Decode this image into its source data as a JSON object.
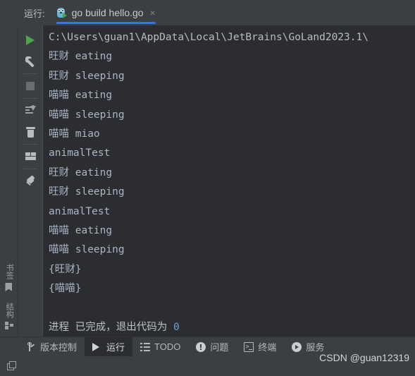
{
  "header": {
    "run_label": "运行:",
    "tab": {
      "title": "go build hello.go",
      "close": "×",
      "icon": "go-gopher-icon",
      "active_underline_color": "#3574F0"
    }
  },
  "left_strip": {
    "items": [
      {
        "label": "书签",
        "icon": "bookmark-icon"
      },
      {
        "label": "结构",
        "icon": "structure-icon"
      }
    ]
  },
  "run_toolbar": {
    "buttons": [
      {
        "name": "rerun-button",
        "icon": "play-icon"
      },
      {
        "name": "edit-configuration-button",
        "icon": "wrench-icon"
      },
      {
        "name": "stop-button",
        "icon": "stop-icon"
      },
      {
        "name": "scroll-to-end-button",
        "icon": "scroll-to-end-icon"
      },
      {
        "name": "clear-all-button",
        "icon": "trash-icon"
      },
      {
        "name": "layout-settings-button",
        "icon": "layout-icon"
      },
      {
        "name": "pin-tab-button",
        "icon": "pin-icon"
      }
    ]
  },
  "console": {
    "lines": [
      {
        "text": "C:\\Users\\guan1\\AppData\\Local\\JetBrains\\GoLand2023.1\\",
        "type": "path"
      },
      {
        "text": "旺财 eating",
        "type": "out"
      },
      {
        "text": "旺财 sleeping",
        "type": "out"
      },
      {
        "text": "喵喵 eating",
        "type": "out"
      },
      {
        "text": "喵喵 sleeping",
        "type": "out"
      },
      {
        "text": "喵喵 miao",
        "type": "out"
      },
      {
        "text": "animalTest",
        "type": "out"
      },
      {
        "text": "旺财 eating",
        "type": "out"
      },
      {
        "text": "旺财 sleeping",
        "type": "out"
      },
      {
        "text": "animalTest",
        "type": "out"
      },
      {
        "text": "喵喵 eating",
        "type": "out"
      },
      {
        "text": "喵喵 sleeping",
        "type": "out"
      },
      {
        "text": "{旺财}",
        "type": "out"
      },
      {
        "text": "{喵喵}",
        "type": "out"
      },
      {
        "text": "",
        "type": "blank"
      },
      {
        "text": "进程 已完成，退出代码为 0",
        "type": "exit",
        "exit_code": "0"
      }
    ],
    "background_color": "#2B2D30",
    "text_color": "#BCC0C4"
  },
  "bottom_bar": {
    "items": [
      {
        "label": "版本控制",
        "icon": "vcs-branch-icon",
        "active": false
      },
      {
        "label": "运行",
        "icon": "run-play-icon",
        "active": true
      },
      {
        "label": "TODO",
        "icon": "todo-list-icon",
        "active": false
      },
      {
        "label": "问题",
        "icon": "problem-warning-icon",
        "active": false
      },
      {
        "label": "终端",
        "icon": "terminal-icon",
        "active": false
      },
      {
        "label": "服务",
        "icon": "services-icon",
        "active": false
      }
    ]
  },
  "status_bar": {
    "window_icon": "window-layout-icon",
    "watermark": "CSDN @guan12319"
  }
}
